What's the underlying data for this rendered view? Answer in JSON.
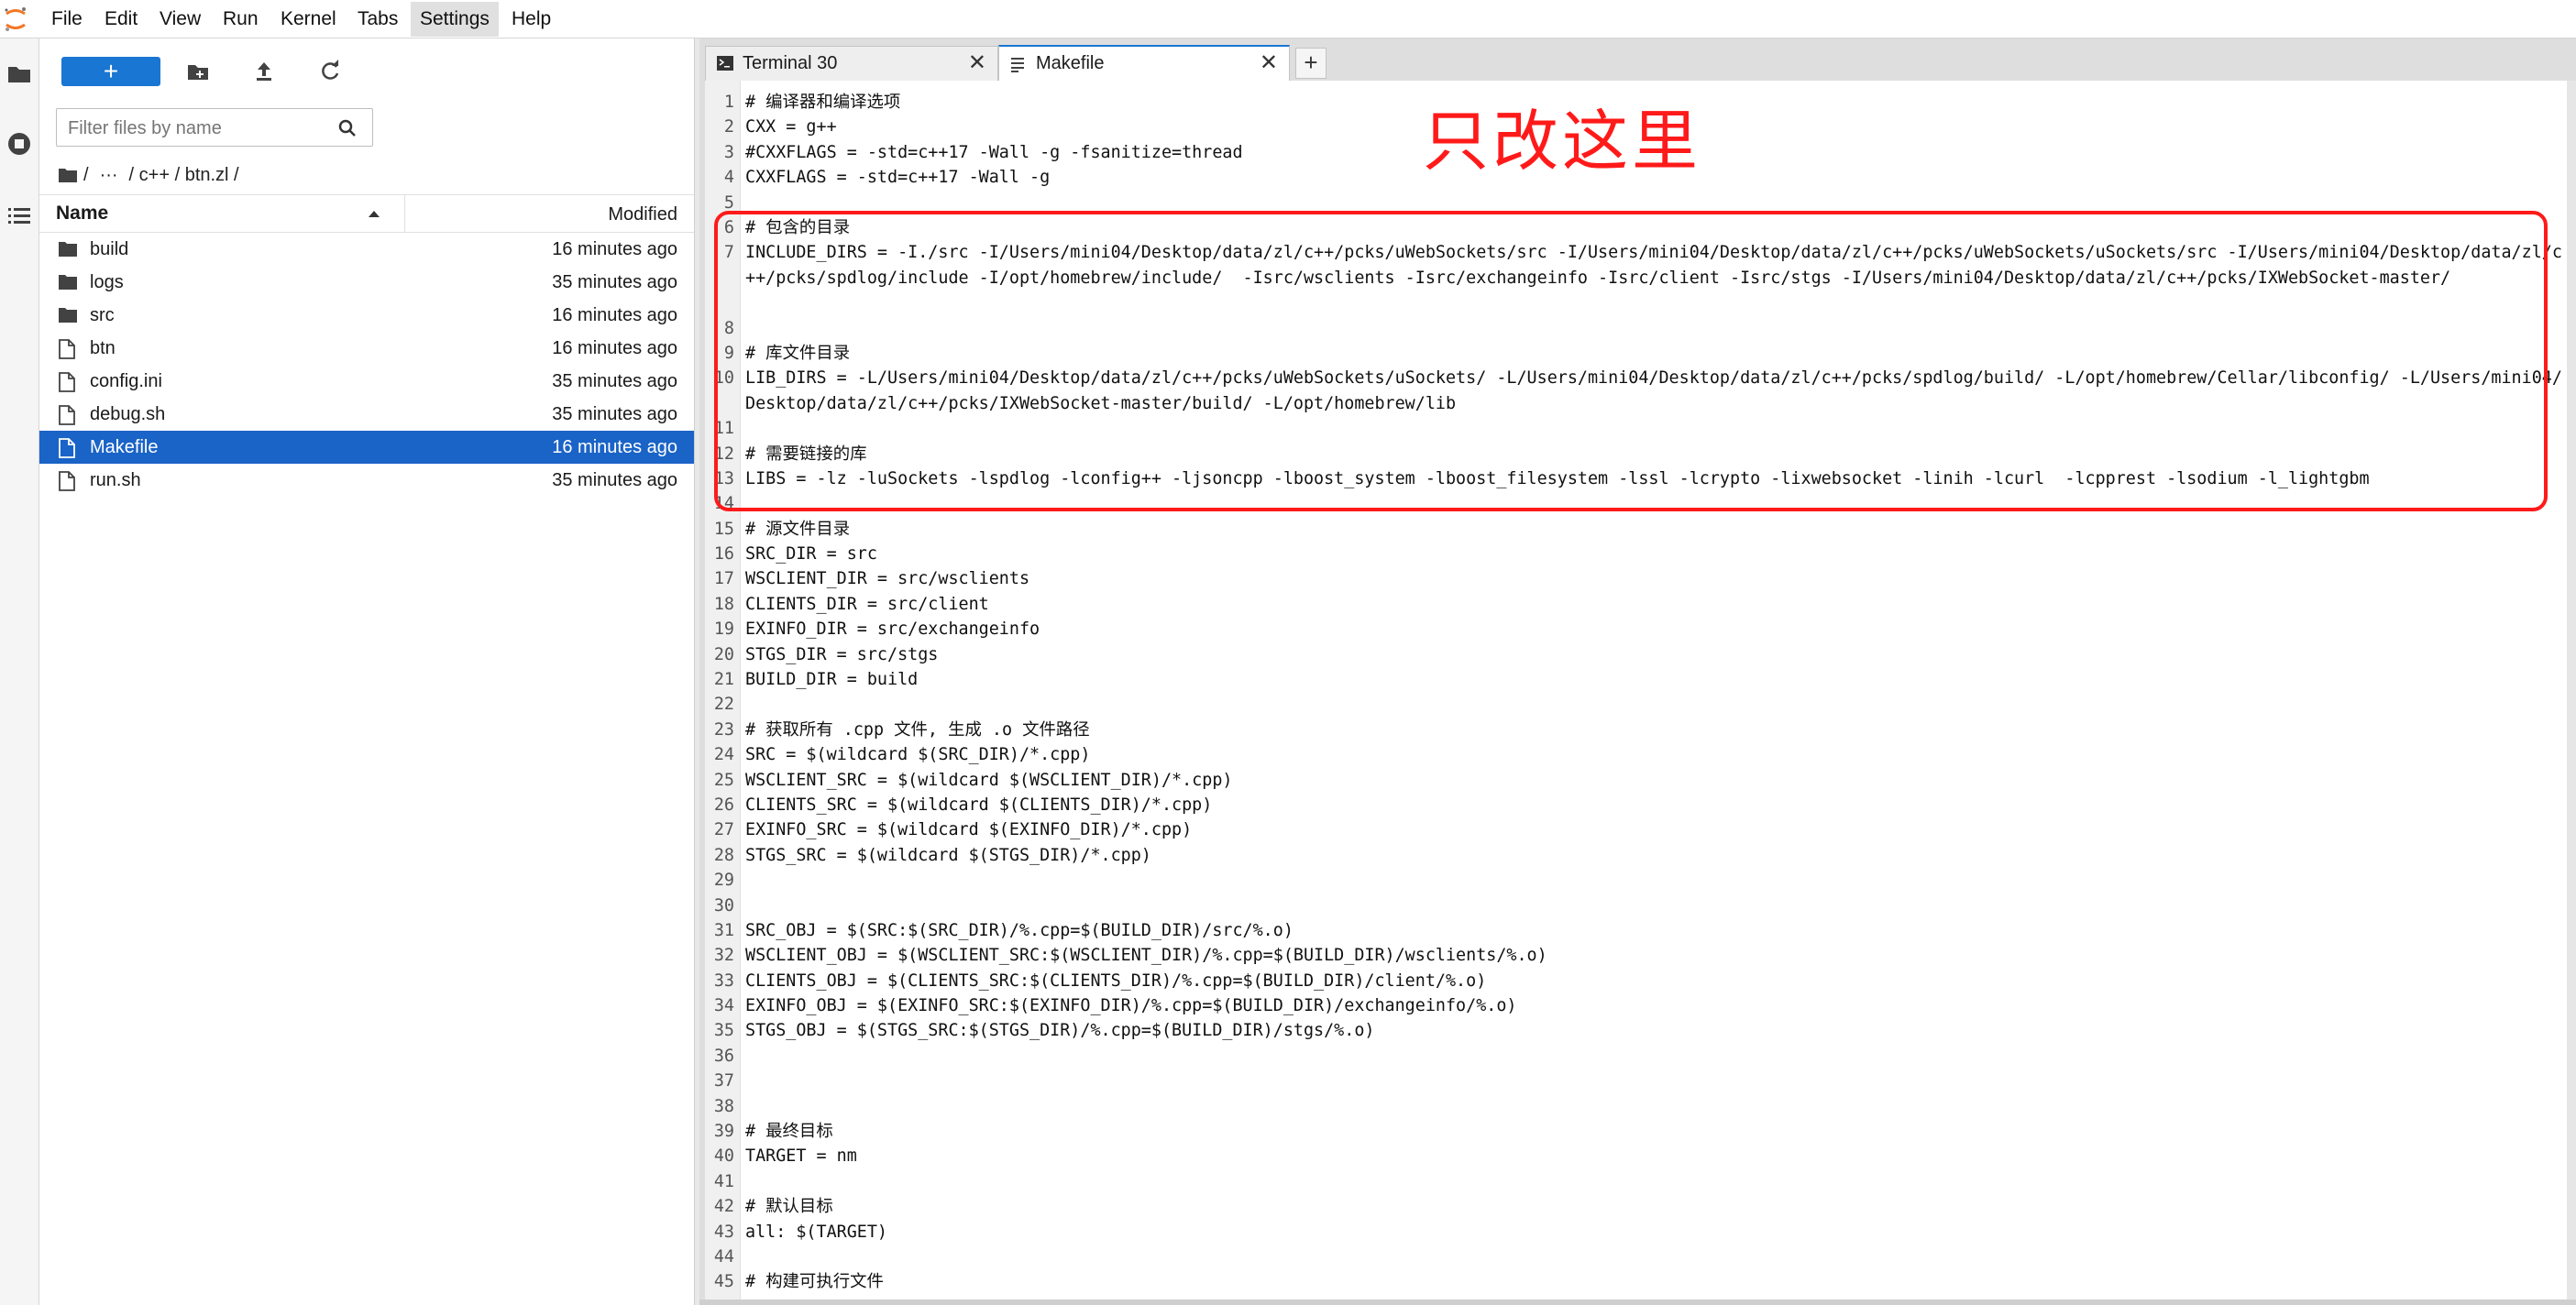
{
  "menu": {
    "items": [
      {
        "label": "File"
      },
      {
        "label": "Edit"
      },
      {
        "label": "View"
      },
      {
        "label": "Run"
      },
      {
        "label": "Kernel"
      },
      {
        "label": "Tabs"
      },
      {
        "label": "Settings"
      },
      {
        "label": "Help"
      }
    ],
    "active": "Settings"
  },
  "activity_bar": {
    "icons": [
      "folder-icon",
      "running-stop-icon",
      "toc-list-icon"
    ]
  },
  "file_browser": {
    "new_button_label": "+",
    "filter_placeholder": "Filter files by name",
    "breadcrumb": {
      "root": "/",
      "ellipsis": "···",
      "path": "/ c++ / btn.zl /"
    },
    "header": {
      "name": "Name",
      "modified": "Modified"
    },
    "files": [
      {
        "name": "build",
        "type": "folder",
        "modified": "16 minutes ago"
      },
      {
        "name": "logs",
        "type": "folder",
        "modified": "35 minutes ago"
      },
      {
        "name": "src",
        "type": "folder",
        "modified": "16 minutes ago"
      },
      {
        "name": "btn",
        "type": "file",
        "modified": "16 minutes ago"
      },
      {
        "name": "config.ini",
        "type": "file",
        "modified": "35 minutes ago"
      },
      {
        "name": "debug.sh",
        "type": "file",
        "modified": "35 minutes ago"
      },
      {
        "name": "Makefile",
        "type": "file",
        "modified": "16 minutes ago",
        "selected": true
      },
      {
        "name": "run.sh",
        "type": "file",
        "modified": "35 minutes ago"
      }
    ]
  },
  "tabs": {
    "items": [
      {
        "label": "Terminal 30",
        "close": "✕"
      },
      {
        "label": "Makefile",
        "close": "✕"
      }
    ],
    "add_label": "+"
  },
  "editor": {
    "lines": [
      {
        "n": "1",
        "text": "# 编译器和编译选项"
      },
      {
        "n": "2",
        "text": "CXX = g++"
      },
      {
        "n": "3",
        "text": "#CXXFLAGS = -std=c++17 -Wall -g -fsanitize=thread"
      },
      {
        "n": "4",
        "text": "CXXFLAGS = -std=c++17 -Wall -g"
      },
      {
        "n": "5",
        "text": ""
      },
      {
        "n": "6",
        "text": "# 包含的目录"
      },
      {
        "n": "7",
        "text": "INCLUDE_DIRS = -I./src -I/Users/mini04/Desktop/data/zl/c++/pcks/uWebSockets/src -I/Users/mini04/Desktop/data/zl/c++/pcks/uWebSockets/uSockets/src -I/Users/mini04/Desktop/data/zl/c++/pcks/spdlog/include -I/opt/homebrew/include/  -Isrc/wsclients -Isrc/exchangeinfo -Isrc/client -Isrc/stgs -I/Users/mini04/Desktop/data/zl/c++/pcks/IXWebSocket-master/"
      },
      {
        "n": "8",
        "text": ""
      },
      {
        "n": "9",
        "text": "# 库文件目录"
      },
      {
        "n": "10",
        "text": "LIB_DIRS = -L/Users/mini04/Desktop/data/zl/c++/pcks/uWebSockets/uSockets/ -L/Users/mini04/Desktop/data/zl/c++/pcks/spdlog/build/ -L/opt/homebrew/Cellar/libconfig/ -L/Users/mini04/Desktop/data/zl/c++/pcks/IXWebSocket-master/build/ -L/opt/homebrew/lib"
      },
      {
        "n": "11",
        "text": ""
      },
      {
        "n": "12",
        "text": "# 需要链接的库"
      },
      {
        "n": "13",
        "text": "LIBS = -lz -luSockets -lspdlog -lconfig++ -ljsoncpp -lboost_system -lboost_filesystem -lssl -lcrypto -lixwebsocket -linih -lcurl  -lcpprest -lsodium -l_lightgbm"
      },
      {
        "n": "14",
        "text": ""
      },
      {
        "n": "15",
        "text": "# 源文件目录"
      },
      {
        "n": "16",
        "text": "SRC_DIR = src"
      },
      {
        "n": "17",
        "text": "WSCLIENT_DIR = src/wsclients"
      },
      {
        "n": "18",
        "text": "CLIENTS_DIR = src/client"
      },
      {
        "n": "19",
        "text": "EXINFO_DIR = src/exchangeinfo"
      },
      {
        "n": "20",
        "text": "STGS_DIR = src/stgs"
      },
      {
        "n": "21",
        "text": "BUILD_DIR = build"
      },
      {
        "n": "22",
        "text": ""
      },
      {
        "n": "23",
        "text": "# 获取所有 .cpp 文件, 生成 .o 文件路径"
      },
      {
        "n": "24",
        "text": "SRC = $(wildcard $(SRC_DIR)/*.cpp)"
      },
      {
        "n": "25",
        "text": "WSCLIENT_SRC = $(wildcard $(WSCLIENT_DIR)/*.cpp)"
      },
      {
        "n": "26",
        "text": "CLIENTS_SRC = $(wildcard $(CLIENTS_DIR)/*.cpp)"
      },
      {
        "n": "27",
        "text": "EXINFO_SRC = $(wildcard $(EXINFO_DIR)/*.cpp)"
      },
      {
        "n": "28",
        "text": "STGS_SRC = $(wildcard $(STGS_DIR)/*.cpp)"
      },
      {
        "n": "29",
        "text": ""
      },
      {
        "n": "30",
        "text": ""
      },
      {
        "n": "31",
        "text": "SRC_OBJ = $(SRC:$(SRC_DIR)/%.cpp=$(BUILD_DIR)/src/%.o)"
      },
      {
        "n": "32",
        "text": "WSCLIENT_OBJ = $(WSCLIENT_SRC:$(WSCLIENT_DIR)/%.cpp=$(BUILD_DIR)/wsclients/%.o)"
      },
      {
        "n": "33",
        "text": "CLIENTS_OBJ = $(CLIENTS_SRC:$(CLIENTS_DIR)/%.cpp=$(BUILD_DIR)/client/%.o)"
      },
      {
        "n": "34",
        "text": "EXINFO_OBJ = $(EXINFO_SRC:$(EXINFO_DIR)/%.cpp=$(BUILD_DIR)/exchangeinfo/%.o)"
      },
      {
        "n": "35",
        "text": "STGS_OBJ = $(STGS_SRC:$(STGS_DIR)/%.cpp=$(BUILD_DIR)/stgs/%.o)"
      },
      {
        "n": "36",
        "text": ""
      },
      {
        "n": "37",
        "text": ""
      },
      {
        "n": "38",
        "text": ""
      },
      {
        "n": "39",
        "text": "# 最终目标"
      },
      {
        "n": "40",
        "text": "TARGET = nm"
      },
      {
        "n": "41",
        "text": ""
      },
      {
        "n": "42",
        "text": "# 默认目标"
      },
      {
        "n": "43",
        "text": "all: $(TARGET)"
      },
      {
        "n": "44",
        "text": ""
      },
      {
        "n": "45",
        "text": "# 构建可执行文件"
      }
    ]
  },
  "annotation": {
    "text": "只改这里",
    "color": "#ff1a1a"
  },
  "colors": {
    "accent": "#1976d2",
    "selected_row": "#1a63c7"
  }
}
